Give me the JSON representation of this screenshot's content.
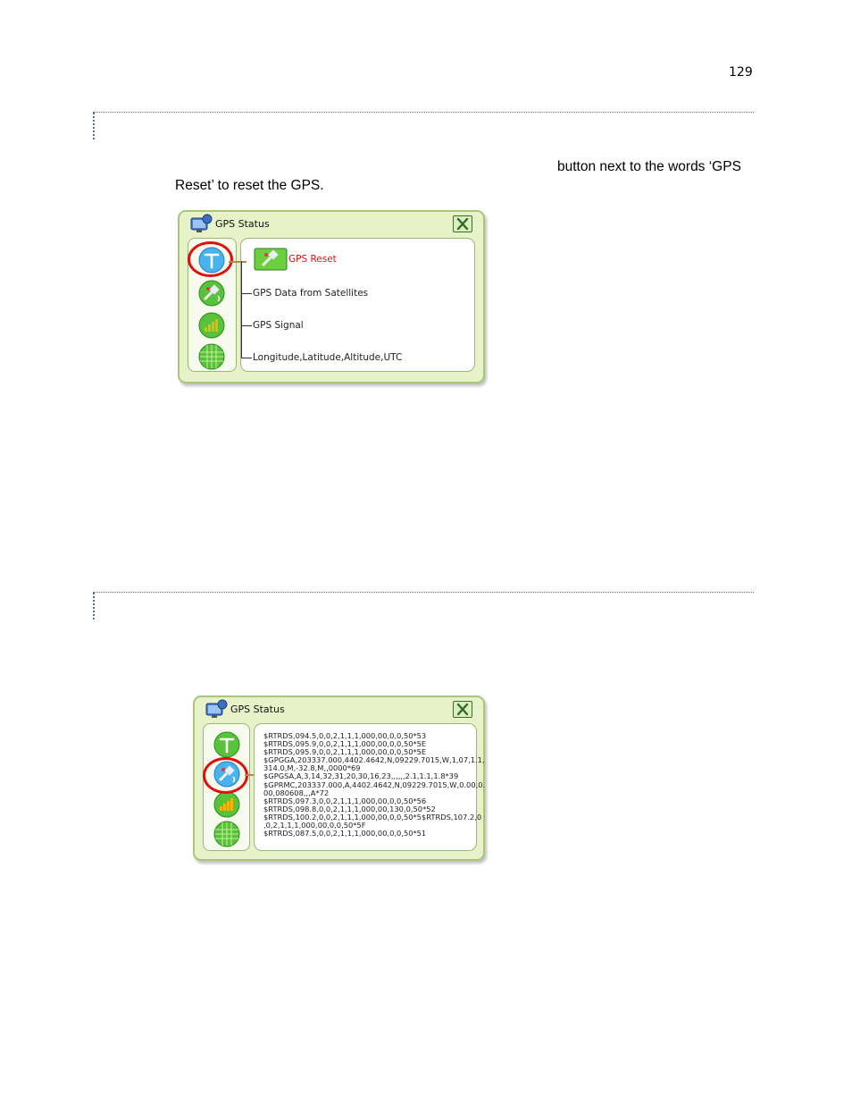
{
  "page": {
    "number": "129"
  },
  "section1": {
    "line1": "button next to the words ‘GPS",
    "line2": "Reset’ to reset the GPS."
  },
  "window1": {
    "title": "GPS Status",
    "items": [
      {
        "label": "GPS Reset",
        "icon": "gps-reset-icon"
      },
      {
        "label": "GPS Data from Satellites",
        "icon": "satellite-icon"
      },
      {
        "label": "GPS Signal",
        "icon": "signal-bars-icon"
      },
      {
        "label": "Longitude,Latitude,Altitude,UTC",
        "icon": "globe-grid-icon"
      }
    ],
    "highlighted": "GPS Reset"
  },
  "window2": {
    "title": "GPS Status",
    "nmea_lines": [
      "$RTRDS,094.5,0,0,2,1,1,1,000,00,0,0,50*53",
      "$RTRDS,095.9,0,0,2,1,1,1,000,00,0,0,50*5E",
      "$RTRDS,095.9,0,0,2,1,1,1,000,00,0,0,50*5E",
      "$GPGGA,203337.000,4402.4642,N,09229.7015,W,1,07,1.1,",
      "314.0,M,-32.8,M,,0000*69",
      "$GPGSA,A,3,14,32,31,20,30,16,23,,,,,,2.1,1.1,1.8*39",
      "$GPRMC,203337.000,A,4402.4642,N,09229.7015,W,0.00,0.",
      "00,080608,,,A*72",
      "$RTRDS,097.3,0,0,2,1,1,1,000,00,0,0,50*56",
      "$RTRDS,098.8,0,0,2,1,1,1,000,00,130,0,50*52",
      "$RTRDS,100.2,0,0,2,1,1,1,000,00,0,0,50*5$RTRDS,107.2,0",
      ",0,2,1,1,1,000,00,0,0,50*5F",
      "$RTRDS,087.5,0,0,2,1,1,1,000,00,0,0,50*51"
    ],
    "highlighted": "satellite-icon"
  },
  "colors": {
    "window_bg": "#e7f2c9",
    "window_border": "#a9c57a",
    "highlight_ring": "#e01010",
    "rule": "#4b6fa8"
  }
}
